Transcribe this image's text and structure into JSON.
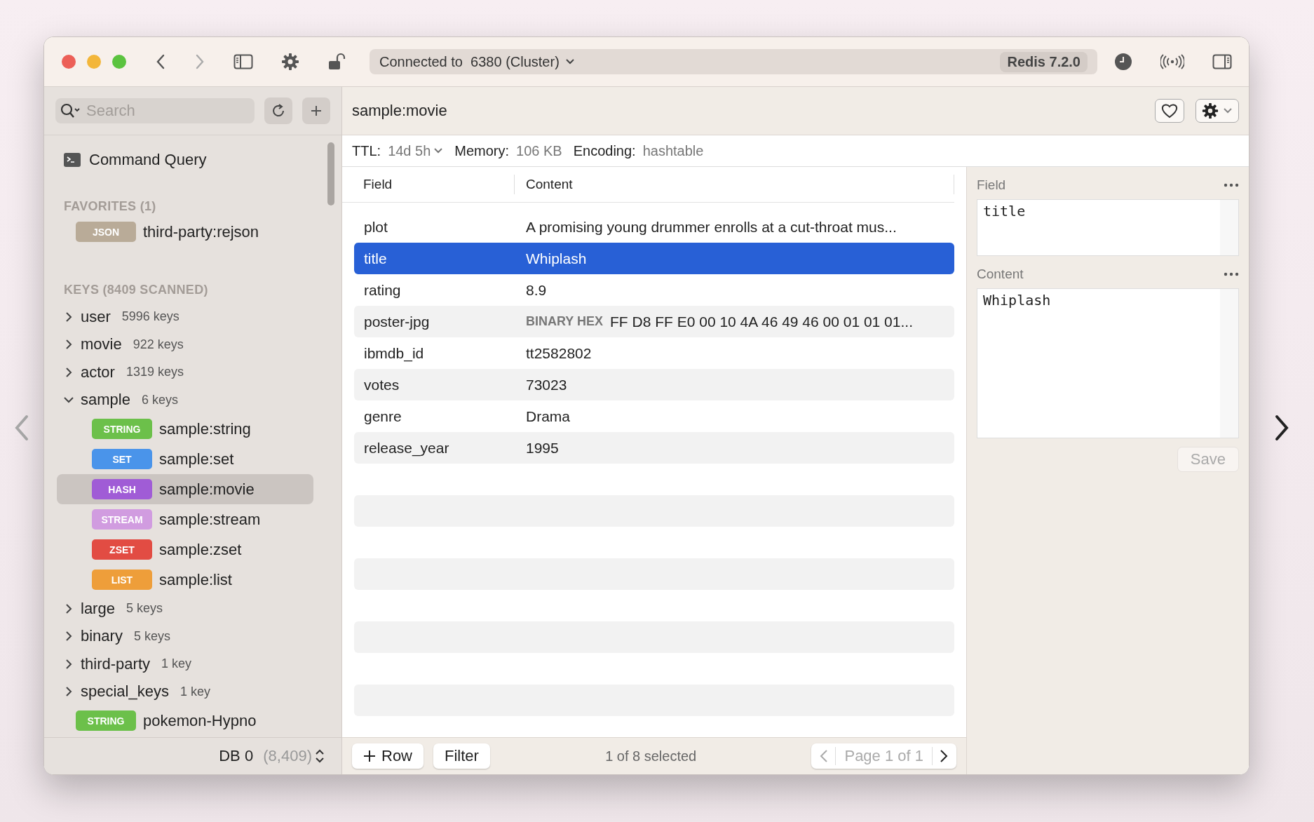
{
  "toolbar": {
    "connection": "Connected to  6380 (Cluster)",
    "server_badge": "Redis 7.2.0"
  },
  "sidebar": {
    "search": {
      "placeholder": "Search"
    },
    "command_query": "Command Query",
    "favorites_heading": "FAVORITES (1)",
    "favorites": [
      {
        "type": "JSON",
        "color": "#b9ab98",
        "name": "third-party:rejson"
      }
    ],
    "keys_heading": "KEYS (8409 SCANNED)",
    "tree": [
      {
        "kind": "folder",
        "name": "user",
        "count": "5996 keys",
        "expanded": false
      },
      {
        "kind": "folder",
        "name": "movie",
        "count": "922 keys",
        "expanded": false
      },
      {
        "kind": "folder",
        "name": "actor",
        "count": "1319 keys",
        "expanded": false
      },
      {
        "kind": "folder",
        "name": "sample",
        "count": "6 keys",
        "expanded": true,
        "children": [
          {
            "type": "STRING",
            "color": "#6cc04a",
            "name": "sample:string",
            "selected": false
          },
          {
            "type": "SET",
            "color": "#4a94ea",
            "name": "sample:set",
            "selected": false
          },
          {
            "type": "HASH",
            "color": "#a05cd6",
            "name": "sample:movie",
            "selected": true
          },
          {
            "type": "STREAM",
            "color": "#d19ce0",
            "name": "sample:stream",
            "selected": false
          },
          {
            "type": "ZSET",
            "color": "#e24c43",
            "name": "sample:zset",
            "selected": false
          },
          {
            "type": "LIST",
            "color": "#ee9e3a",
            "name": "sample:list",
            "selected": false
          }
        ]
      },
      {
        "kind": "folder",
        "name": "large",
        "count": "5 keys",
        "expanded": false
      },
      {
        "kind": "folder",
        "name": "binary",
        "count": "5 keys",
        "expanded": false
      },
      {
        "kind": "folder",
        "name": "third-party",
        "count": "1 key",
        "expanded": false
      },
      {
        "kind": "folder",
        "name": "special_keys",
        "count": "1 key",
        "expanded": false
      },
      {
        "kind": "key",
        "type": "STRING",
        "color": "#6cc04a",
        "name": "pokemon-Hypno",
        "selected": false
      }
    ],
    "db": "DB 0",
    "db_count": "(8,409)"
  },
  "key": {
    "name": "sample:movie",
    "ttl_label": "TTL:",
    "ttl": "14d 5h",
    "memory_label": "Memory:",
    "memory": "106 KB",
    "encoding_label": "Encoding:",
    "encoding": "hashtable"
  },
  "table": {
    "columns": [
      "Field",
      "Content"
    ],
    "rows": [
      {
        "field": "plot",
        "content": "A promising young drummer enrolls at a cut-throat mus...",
        "selected": false
      },
      {
        "field": "title",
        "content": "Whiplash",
        "selected": true
      },
      {
        "field": "rating",
        "content": "8.9",
        "selected": false
      },
      {
        "field": "poster-jpg",
        "tag": "BINARY HEX",
        "content": "FF D8 FF E0 00 10 4A 46 49 46 00 01 01 01...",
        "selected": false
      },
      {
        "field": "ibmdb_id",
        "content": "tt2582802",
        "selected": false
      },
      {
        "field": "votes",
        "content": "73023",
        "selected": false
      },
      {
        "field": "genre",
        "content": "Drama",
        "selected": false
      },
      {
        "field": "release_year",
        "content": "1995",
        "selected": false
      }
    ]
  },
  "footer": {
    "add_row": "Row",
    "filter": "Filter",
    "selection": "1 of 8 selected",
    "page": "Page 1 of 1"
  },
  "editor": {
    "field_label": "Field",
    "field_value": "title",
    "content_label": "Content",
    "content_value": "Whiplash",
    "save": "Save"
  }
}
